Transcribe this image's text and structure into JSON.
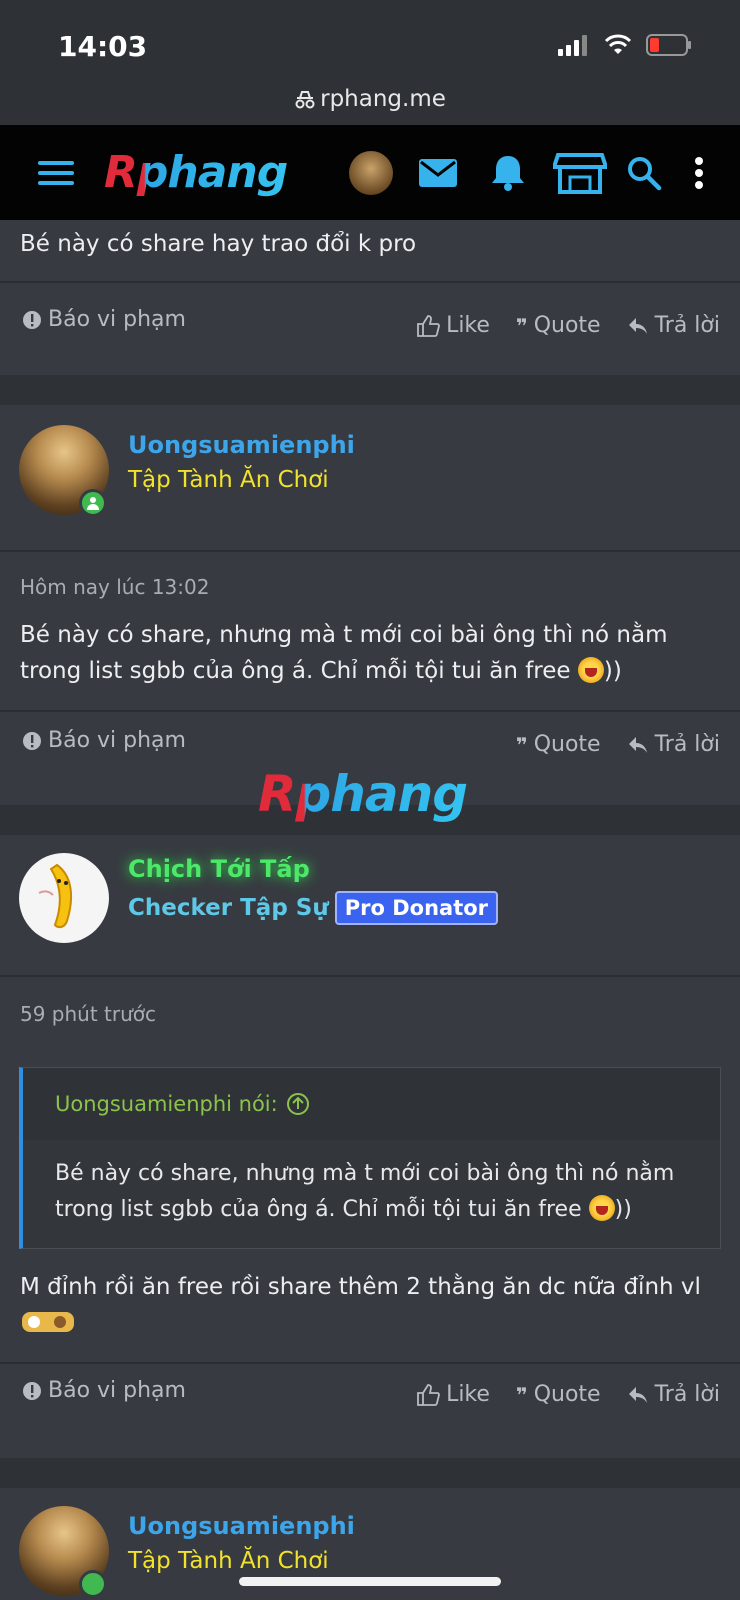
{
  "status": {
    "time": "14:03",
    "url": "rphang.me"
  },
  "nav": {
    "logo": "Rphang"
  },
  "actions": {
    "report": "Báo vi phạm",
    "like": "Like",
    "quote": "Quote",
    "reply": "Trả lời"
  },
  "posts": [
    {
      "body": "Bé này có share hay trao đổi k pro"
    },
    {
      "user": "Uongsuamienphi",
      "title": "Tập Tành Ăn Chơi",
      "time": "Hôm nay lúc 13:02",
      "body_line1": "Bé này có share, nhưng mà t mới coi bài ông thì nó nằm",
      "body_line2": "trong list sgbb của ông á. Chỉ mỗi tội tui ăn free",
      "body_tail": "))"
    },
    {
      "user": "Chịch Tới Tấp",
      "title": "Checker Tập Sự",
      "badge": "Pro Donator",
      "time": "59 phút trước",
      "quote_author": "Uongsuamienphi nói:",
      "quote_line1": "Bé này có share, nhưng mà t mới coi bài ông thì nó nằm",
      "quote_line2": "trong list sgbb của ông á. Chỉ mỗi tội tui ăn free",
      "quote_tail": "))",
      "body": "M đỉnh rồi ăn free rồi share thêm 2 thằng ăn dc nữa đỉnh vl"
    },
    {
      "user": "Uongsuamienphi",
      "title": "Tập Tành Ăn Chơi"
    }
  ],
  "watermark": "Rphang",
  "colors": {
    "username_blue": "#3da5ea",
    "title_yellow": "#f2e22c",
    "green_name": "#4de86a",
    "checker_cyan": "#5ec8e8"
  }
}
